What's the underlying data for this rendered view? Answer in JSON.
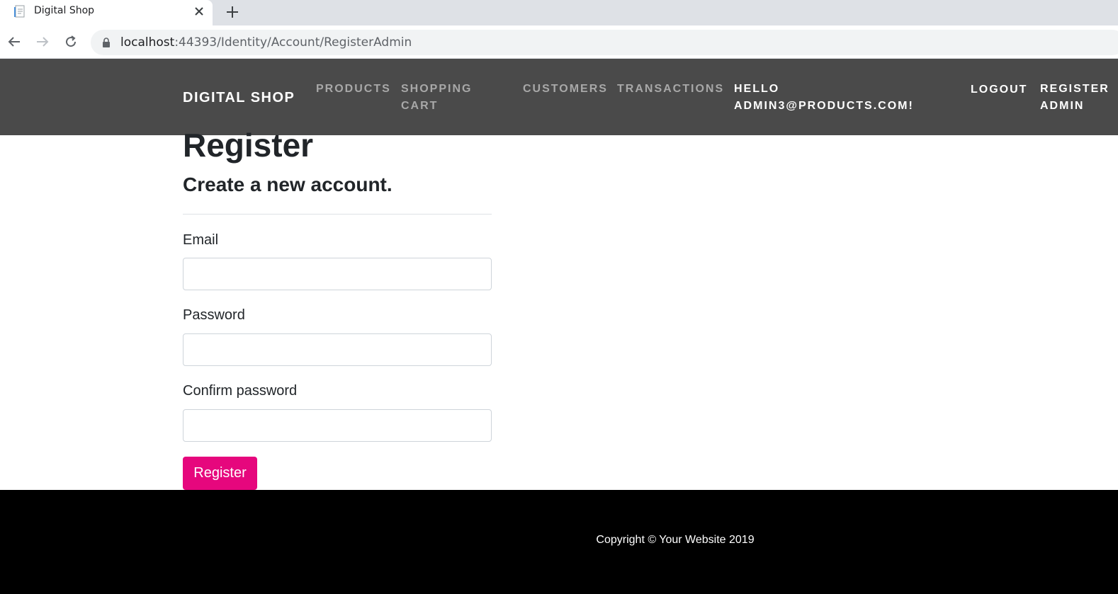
{
  "browser": {
    "tab_title": "Digital Shop",
    "url_host": "localhost",
    "url_rest": ":44393/Identity/Account/RegisterAdmin"
  },
  "navbar": {
    "brand": "DIGITAL SHOP",
    "links": [
      {
        "label": "PRODUCTS"
      },
      {
        "label": "SHOPPING",
        "label2": "CART"
      },
      {
        "label": "CUSTOMERS"
      },
      {
        "label": "TRANSACTIONS"
      }
    ],
    "greeting_line1": "HELLO",
    "greeting_line2": "ADMIN3@PRODUCTS.COM!",
    "logout": "LOGOUT",
    "register_admin_line1": "REGISTER",
    "register_admin_line2": "ADMIN",
    "bg_color": "#4a4a4a"
  },
  "form": {
    "title": "Register",
    "subtitle": "Create a new account.",
    "email_label": "Email",
    "email_value": "",
    "password_label": "Password",
    "password_value": "",
    "confirm_label": "Confirm password",
    "confirm_value": "",
    "submit_label": "Register",
    "accent_color": "#e6077d"
  },
  "footer": {
    "copyright": "Copyright © Your Website 2019"
  }
}
